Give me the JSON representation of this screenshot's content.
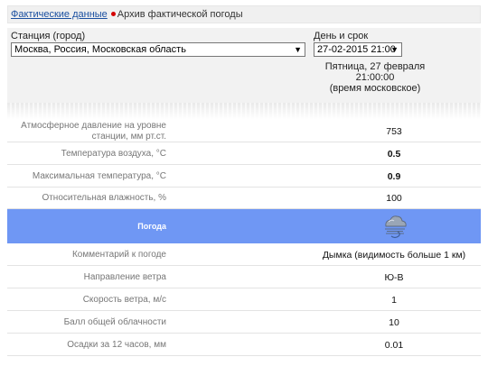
{
  "breadcrumb": {
    "link": "Фактические данные",
    "current": "Архив фактической погоды"
  },
  "station": {
    "label": "Станция (город)",
    "value": "Москва, Россия, Московская область"
  },
  "datetime": {
    "label": "День и срок",
    "value": "27-02-2015 21:00"
  },
  "header": {
    "day": "Пятница, 27 февраля",
    "time": "21:00:00",
    "note": "(время московское)"
  },
  "rows": [
    {
      "label": "Атмосферное давление на уровне станции, мм рт.ст.",
      "value": "753"
    },
    {
      "label": "Температура воздуха, °C",
      "value": "0.5"
    },
    {
      "label": "Максимальная температура, °C",
      "value": "0.9"
    },
    {
      "label": "Относительная влажность, %",
      "value": "100"
    }
  ],
  "weather": {
    "label": "Погода",
    "icon": "haze-cloud-icon"
  },
  "rows2": [
    {
      "label": "Комментарий к погоде",
      "value": "Дымка (видимость больше 1 км)"
    },
    {
      "label": "Направление ветра",
      "value": "Ю-В"
    },
    {
      "label": "Скорость ветра, м/с",
      "value": "1"
    },
    {
      "label": "Балл общей облачности",
      "value": "10"
    },
    {
      "label": "Осадки за 12 часов, мм",
      "value": "0.01"
    }
  ],
  "colors": {
    "weather_band": "#6f97f4",
    "link": "#1a4fa0",
    "separator": "#d40000"
  }
}
